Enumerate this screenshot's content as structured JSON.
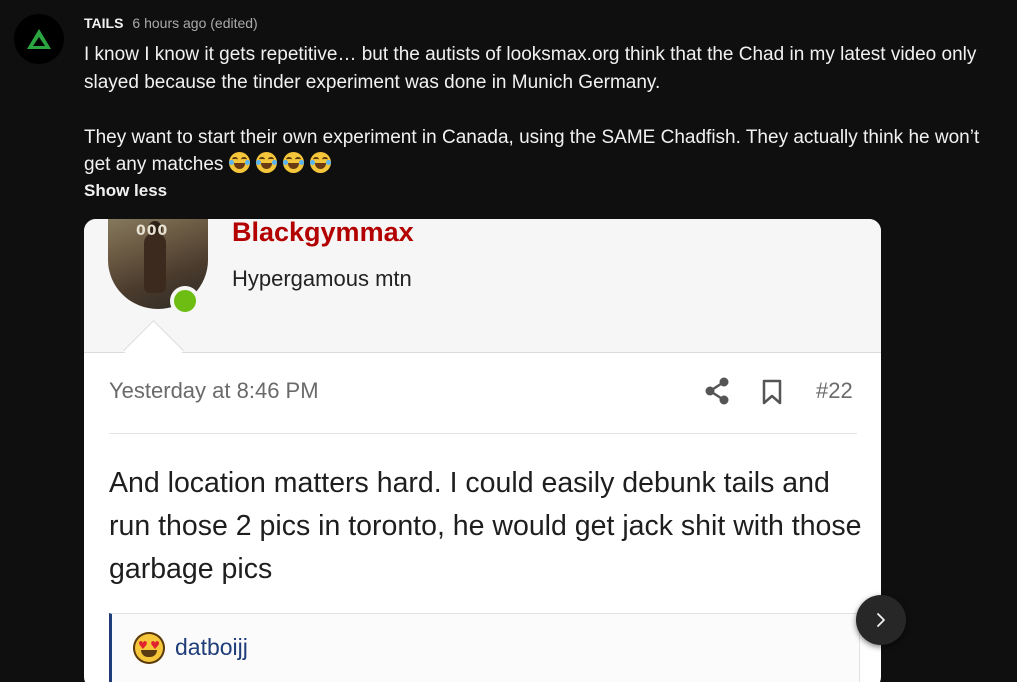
{
  "comment": {
    "author": "TAILS",
    "timestamp": "6 hours ago (edited)",
    "paragraph1": "I know I know it gets repetitive… but the autists of looksmax.org think that the Chad in my latest video only slayed because the tinder experiment was done in Munich Germany.",
    "paragraph2": "They want to start their own experiment in Canada, using the SAME Chadfish. They actually think he won’t get any matches",
    "emoji_count": 4,
    "show_less_label": "Show less"
  },
  "forum_post": {
    "username": "Blackgymmax",
    "user_title": "Hypergamous mtn",
    "profile_pic_digits": "000",
    "date": "Yesterday at 8:46 PM",
    "post_number": "#22",
    "message": "And location matters hard. I could easily debunk tails and run those 2 pics in toronto, he would get jack shit with those garbage pics",
    "quote_author": "datboijj"
  },
  "icons": {
    "channel_avatar": "triangle-logo-icon",
    "laugh_emoji": "tears-of-joy-emoji-icon",
    "share": "share-icon",
    "bookmark": "bookmark-icon",
    "quote_emoji": "heart-eyes-emoji-icon",
    "next": "chevron-right-icon"
  },
  "colors": {
    "background": "#0f0f0f",
    "text_primary": "#f1f1f1",
    "text_secondary": "#aaaaaa",
    "avatar_accent": "#2ba640",
    "forum_username": "#b30000",
    "forum_quote_accent": "#1f3d78",
    "online_dot": "#6dbd12"
  }
}
